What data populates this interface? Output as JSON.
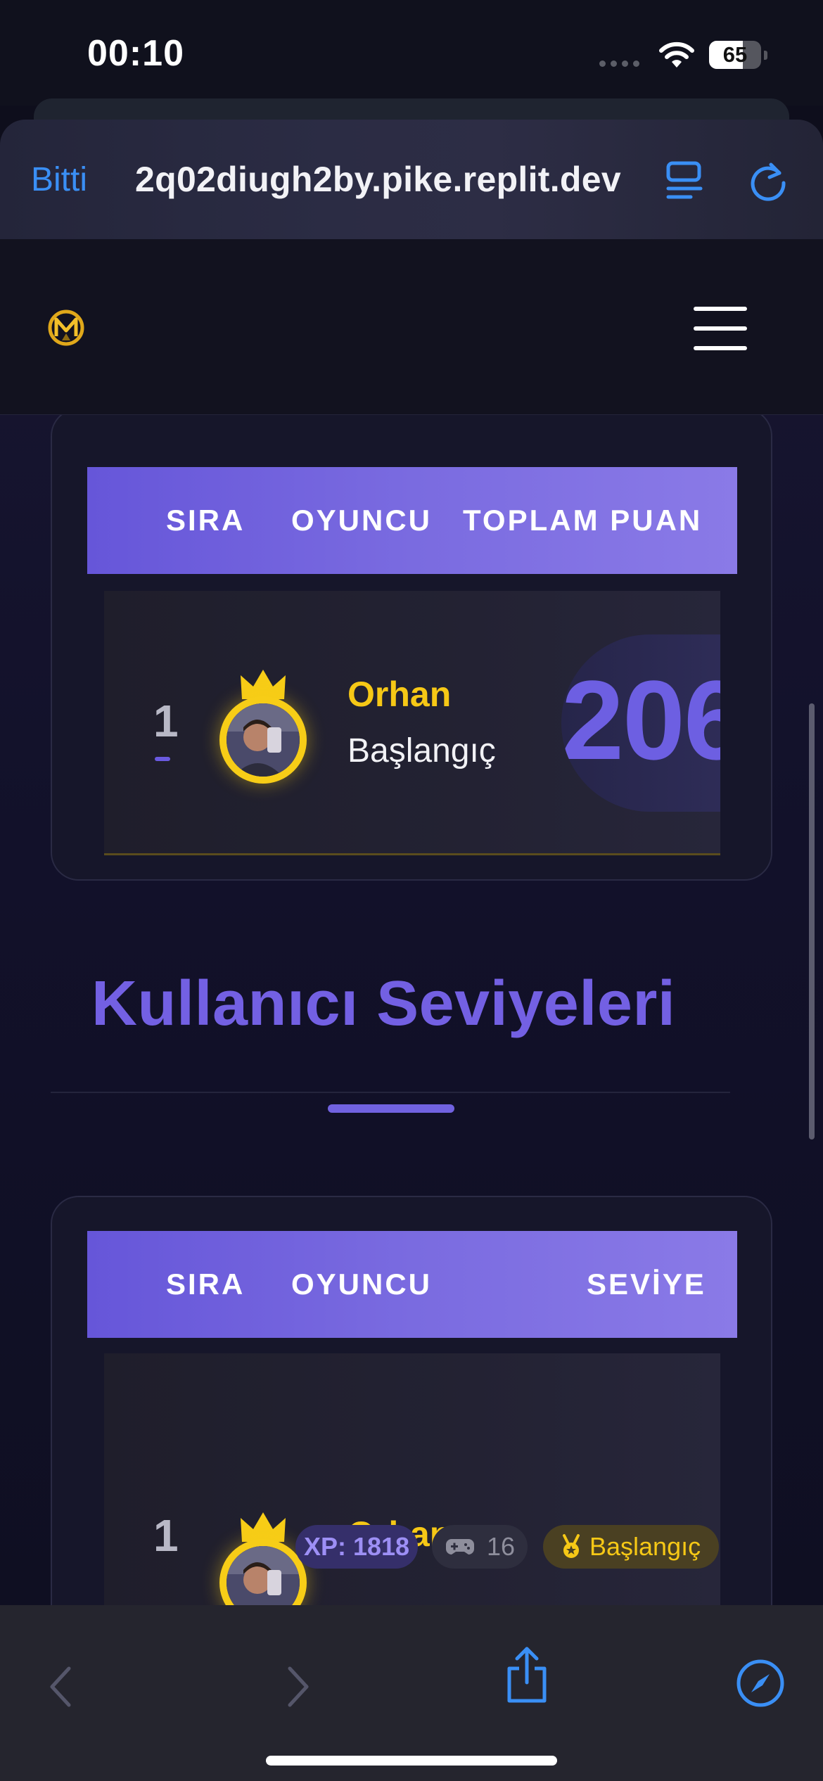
{
  "status_bar": {
    "time": "00:10",
    "battery_percent": "65",
    "battery_level": 0.65
  },
  "browser": {
    "done_label": "Bitti",
    "url": "2q02diugh2by.pike.replit.dev",
    "icons": [
      "reader-view-icon",
      "reload-icon"
    ]
  },
  "site_nav": {
    "logo_icon": "m-logo-icon",
    "menu_icon": "hamburger-menu-icon"
  },
  "points_table": {
    "columns": [
      "SIRA",
      "OYUNCU",
      "TOPLAM PUAN"
    ],
    "rows": [
      {
        "rank": "1",
        "name": "Orhan",
        "level": "Başlangıç",
        "score": "206"
      }
    ]
  },
  "levels_section": {
    "title": "Kullanıcı Seviyeleri"
  },
  "levels_table": {
    "columns": [
      "SIRA",
      "OYUNCU",
      "SEVİYE"
    ],
    "rows": [
      {
        "rank": "1",
        "name": "Orhan",
        "xp": "XP: 1818",
        "games": "16",
        "level_badge": "Başlangıç"
      }
    ]
  },
  "toolbar": {
    "icons": [
      "back-icon",
      "forward-icon",
      "share-icon",
      "compass-icon"
    ]
  },
  "colors": {
    "accent": "#7360e3",
    "gold": "#f6c816",
    "link_blue": "#3a8ff5",
    "background": "#12112a"
  }
}
